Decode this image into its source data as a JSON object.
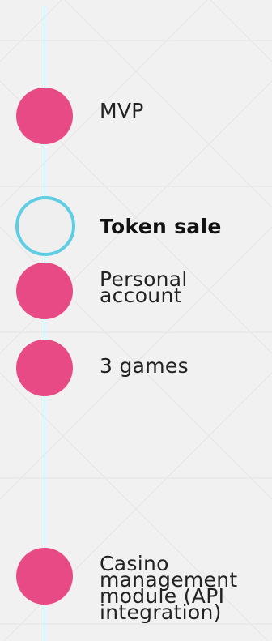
{
  "colors": {
    "line": "#5fcde4",
    "dot": "#e84a86",
    "current_dot_fill": "#efefef",
    "background": "#f1f1f1"
  },
  "timeline": {
    "items": [
      {
        "label": "MVP",
        "state": "done"
      },
      {
        "label": "Token sale",
        "state": "current"
      },
      {
        "label": "Personal account",
        "state": "done"
      },
      {
        "label": "3 games",
        "state": "done"
      },
      {
        "label": "Casino management module (API integration)",
        "state": "done"
      }
    ]
  }
}
